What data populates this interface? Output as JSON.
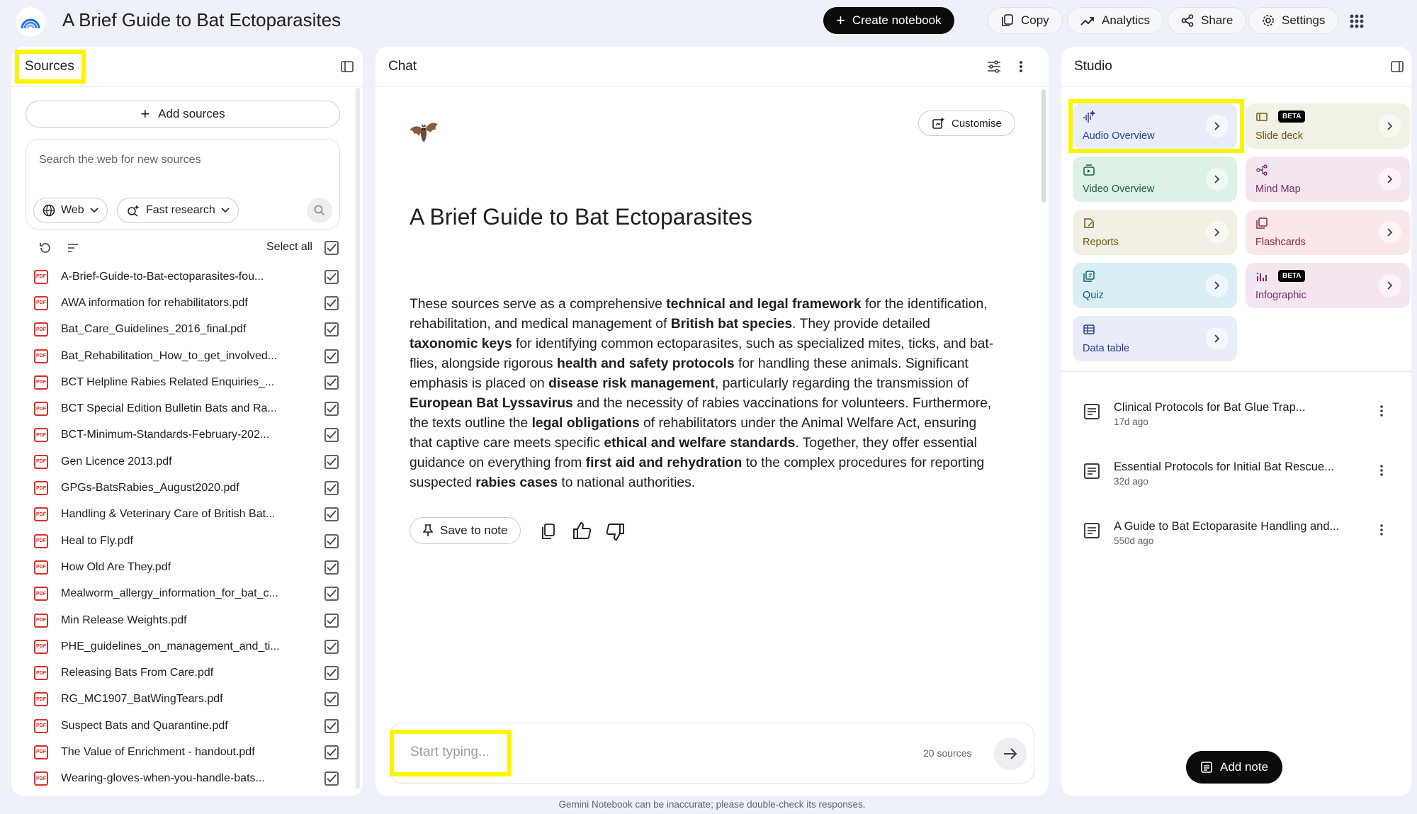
{
  "header": {
    "title": "A Brief Guide to Bat Ectoparasites",
    "create_label": "Create notebook",
    "copy_label": "Copy",
    "analytics_label": "Analytics",
    "share_label": "Share",
    "settings_label": "Settings"
  },
  "sources": {
    "title": "Sources",
    "add_label": "Add sources",
    "search_placeholder": "Search the web for new sources",
    "web_chip": "Web",
    "research_chip": "Fast research",
    "select_all": "Select all",
    "items": [
      "A-Brief-Guide-to-Bat-ectoparasites-fou...",
      "AWA information for rehabilitators.pdf",
      "Bat_Care_Guidelines_2016_final.pdf",
      "Bat_Rehabilitation_How_to_get_involved...",
      "BCT Helpline Rabies Related Enquiries_...",
      "BCT Special Edition Bulletin Bats and Ra...",
      "BCT-Minimum-Standards-February-202...",
      "Gen Licence 2013.pdf",
      "GPGs-BatsRabies_August2020.pdf",
      "Handling & Veterinary Care of British Bat...",
      "Heal to Fly.pdf",
      "How Old Are They.pdf",
      "Mealworm_allergy_information_for_bat_c...",
      "Min Release Weights.pdf",
      "PHE_guidelines_on_management_and_ti...",
      "Releasing Bats From Care.pdf",
      "RG_MC1907_BatWingTears.pdf",
      "Suspect Bats and Quarantine.pdf",
      "The Value of Enrichment - handout.pdf",
      "Wearing-gloves-when-you-handle-bats..."
    ],
    "pdf_badge": "PDF"
  },
  "chat": {
    "title": "Chat",
    "customise_label": "Customise",
    "heading": "A Brief Guide to Bat Ectoparasites",
    "summary": [
      {
        "t": "These sources serve as a comprehensive "
      },
      {
        "t": "technical and legal framework",
        "b": true
      },
      {
        "t": " for the identification, rehabilitation, and medical management of "
      },
      {
        "t": "British bat species",
        "b": true
      },
      {
        "t": ". They provide detailed "
      },
      {
        "t": "taxonomic keys",
        "b": true
      },
      {
        "t": " for identifying common ectoparasites, such as specialized mites, ticks, and bat-flies, alongside rigorous "
      },
      {
        "t": "health and safety protocols",
        "b": true
      },
      {
        "t": " for handling these animals. Significant emphasis is placed on "
      },
      {
        "t": "disease risk management",
        "b": true
      },
      {
        "t": ", particularly regarding the transmission of "
      },
      {
        "t": "European Bat Lyssavirus",
        "b": true
      },
      {
        "t": " and the necessity of rabies vaccinations for volunteers. Furthermore, the texts outline the "
      },
      {
        "t": "legal obligations",
        "b": true
      },
      {
        "t": " of rehabilitators under the Animal Welfare Act, ensuring that captive care meets specific "
      },
      {
        "t": "ethical and welfare standards",
        "b": true
      },
      {
        "t": ". Together, they offer essential guidance on everything from "
      },
      {
        "t": "first aid and rehydration",
        "b": true
      },
      {
        "t": " to the complex procedures for reporting suspected "
      },
      {
        "t": "rabies cases",
        "b": true
      },
      {
        "t": " to national authorities."
      }
    ],
    "save_label": "Save to note",
    "input_placeholder": "Start typing...",
    "source_count": "20 sources",
    "disclaimer": "Gemini Notebook can be inaccurate; please double-check its responses."
  },
  "studio": {
    "title": "Studio",
    "tiles": [
      {
        "label": "Audio Overview",
        "bg": "#e8edf9",
        "fg": "#2c3e8c"
      },
      {
        "label": "Slide deck",
        "bg": "#f2f1e6",
        "fg": "#6b5a16",
        "beta": "BETA"
      },
      {
        "label": "Video Overview",
        "bg": "#dcf2e5",
        "fg": "#19613a"
      },
      {
        "label": "Mind Map",
        "bg": "#f3e6f1",
        "fg": "#7a2a6d"
      },
      {
        "label": "Reports",
        "bg": "#f2f0e4",
        "fg": "#6b5a16"
      },
      {
        "label": "Flashcards",
        "bg": "#f9e7e9",
        "fg": "#8c2a3a"
      },
      {
        "label": "Quiz",
        "bg": "#d9eff4",
        "fg": "#115e72"
      },
      {
        "label": "Infographic",
        "bg": "#f3e6f1",
        "fg": "#7a2a6d",
        "beta": "BETA"
      },
      {
        "label": "Data table",
        "bg": "#e8edf9",
        "fg": "#2c3e8c"
      }
    ],
    "notes": [
      {
        "title": "Clinical Protocols for Bat Glue Trap...",
        "date": "17d ago"
      },
      {
        "title": "Essential Protocols for Initial Bat Rescue...",
        "date": "32d ago"
      },
      {
        "title": "A Guide to Bat Ectoparasite Handling and...",
        "date": "550d ago"
      }
    ],
    "add_note_label": "Add note"
  },
  "colors": {
    "highlight": "#fbf500",
    "pdf_red": "#d93025",
    "dark_button": "#0b0b0b"
  }
}
